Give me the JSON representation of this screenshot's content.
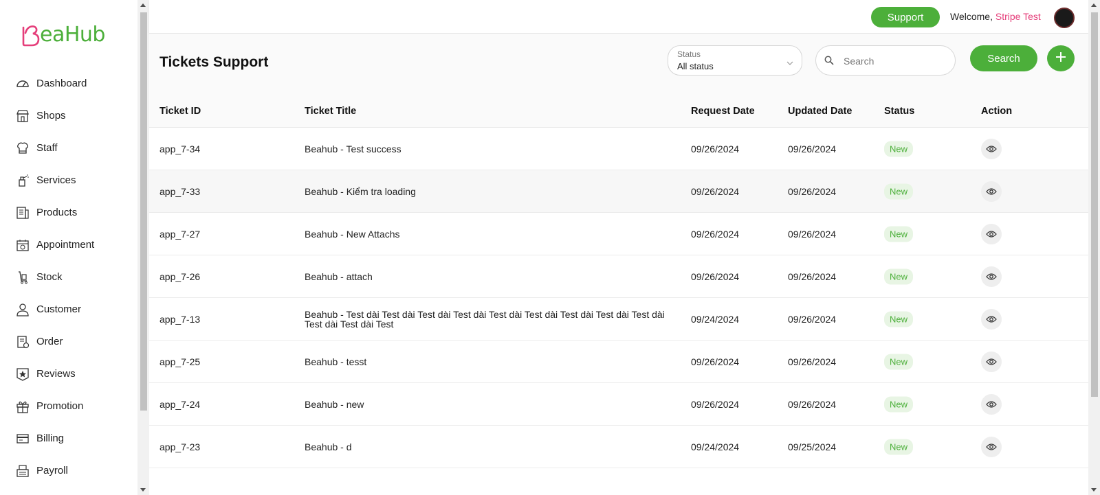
{
  "brand": {
    "logo_text": "eaHub",
    "logo_color": "#4caf3a",
    "logo_mark_color": "#e53e7a"
  },
  "sidebar": {
    "items": [
      {
        "label": "Dashboard",
        "icon": "dashboard-gauge-icon"
      },
      {
        "label": "Shops",
        "icon": "shop-storefront-icon"
      },
      {
        "label": "Staff",
        "icon": "staff-chef-icon"
      },
      {
        "label": "Services",
        "icon": "services-spray-icon"
      },
      {
        "label": "Products",
        "icon": "products-list-icon"
      },
      {
        "label": "Appointment",
        "icon": "appointment-calendar-icon"
      },
      {
        "label": "Stock",
        "icon": "stock-cart-icon"
      },
      {
        "label": "Customer",
        "icon": "customer-person-icon"
      },
      {
        "label": "Order",
        "icon": "order-clipboard-icon"
      },
      {
        "label": "Reviews",
        "icon": "reviews-star-icon"
      },
      {
        "label": "Promotion",
        "icon": "promotion-gift-icon"
      },
      {
        "label": "Billing",
        "icon": "billing-card-icon"
      },
      {
        "label": "Payroll",
        "icon": "payroll-register-icon"
      }
    ]
  },
  "topbar": {
    "support_label": "Support",
    "welcome_prefix": "Welcome,",
    "user_name": "Stripe Test"
  },
  "header": {
    "title": "Tickets Support",
    "status_caption": "Status",
    "status_value": "All status",
    "search_placeholder": "Search",
    "search_button": "Search"
  },
  "table": {
    "columns": [
      "Ticket ID",
      "Ticket Title",
      "Request Date",
      "Updated Date",
      "Status",
      "Action"
    ],
    "rows": [
      {
        "id": "app_7-34",
        "title": "Beahub - Test success",
        "request": "09/26/2024",
        "updated": "09/26/2024",
        "status": "New"
      },
      {
        "id": "app_7-33",
        "title": "Beahub - Kiểm tra loading",
        "request": "09/26/2024",
        "updated": "09/26/2024",
        "status": "New"
      },
      {
        "id": "app_7-27",
        "title": "Beahub - New Attachs",
        "request": "09/26/2024",
        "updated": "09/26/2024",
        "status": "New"
      },
      {
        "id": "app_7-26",
        "title": "Beahub - attach",
        "request": "09/26/2024",
        "updated": "09/26/2024",
        "status": "New"
      },
      {
        "id": "app_7-13",
        "title": "Beahub - Test dài Test dài Test dài Test dài Test dài Test dài Test dài Test dài Test dài Test dài Test dài Test",
        "request": "09/24/2024",
        "updated": "09/26/2024",
        "status": "New"
      },
      {
        "id": "app_7-25",
        "title": "Beahub - tesst",
        "request": "09/26/2024",
        "updated": "09/26/2024",
        "status": "New"
      },
      {
        "id": "app_7-24",
        "title": "Beahub - new",
        "request": "09/26/2024",
        "updated": "09/26/2024",
        "status": "New"
      },
      {
        "id": "app_7-23",
        "title": "Beahub - d",
        "request": "09/24/2024",
        "updated": "09/25/2024",
        "status": "New"
      }
    ]
  },
  "colors": {
    "accent": "#4caf3a",
    "pink": "#e53e7a",
    "badge_bg": "#e8f5e4"
  }
}
